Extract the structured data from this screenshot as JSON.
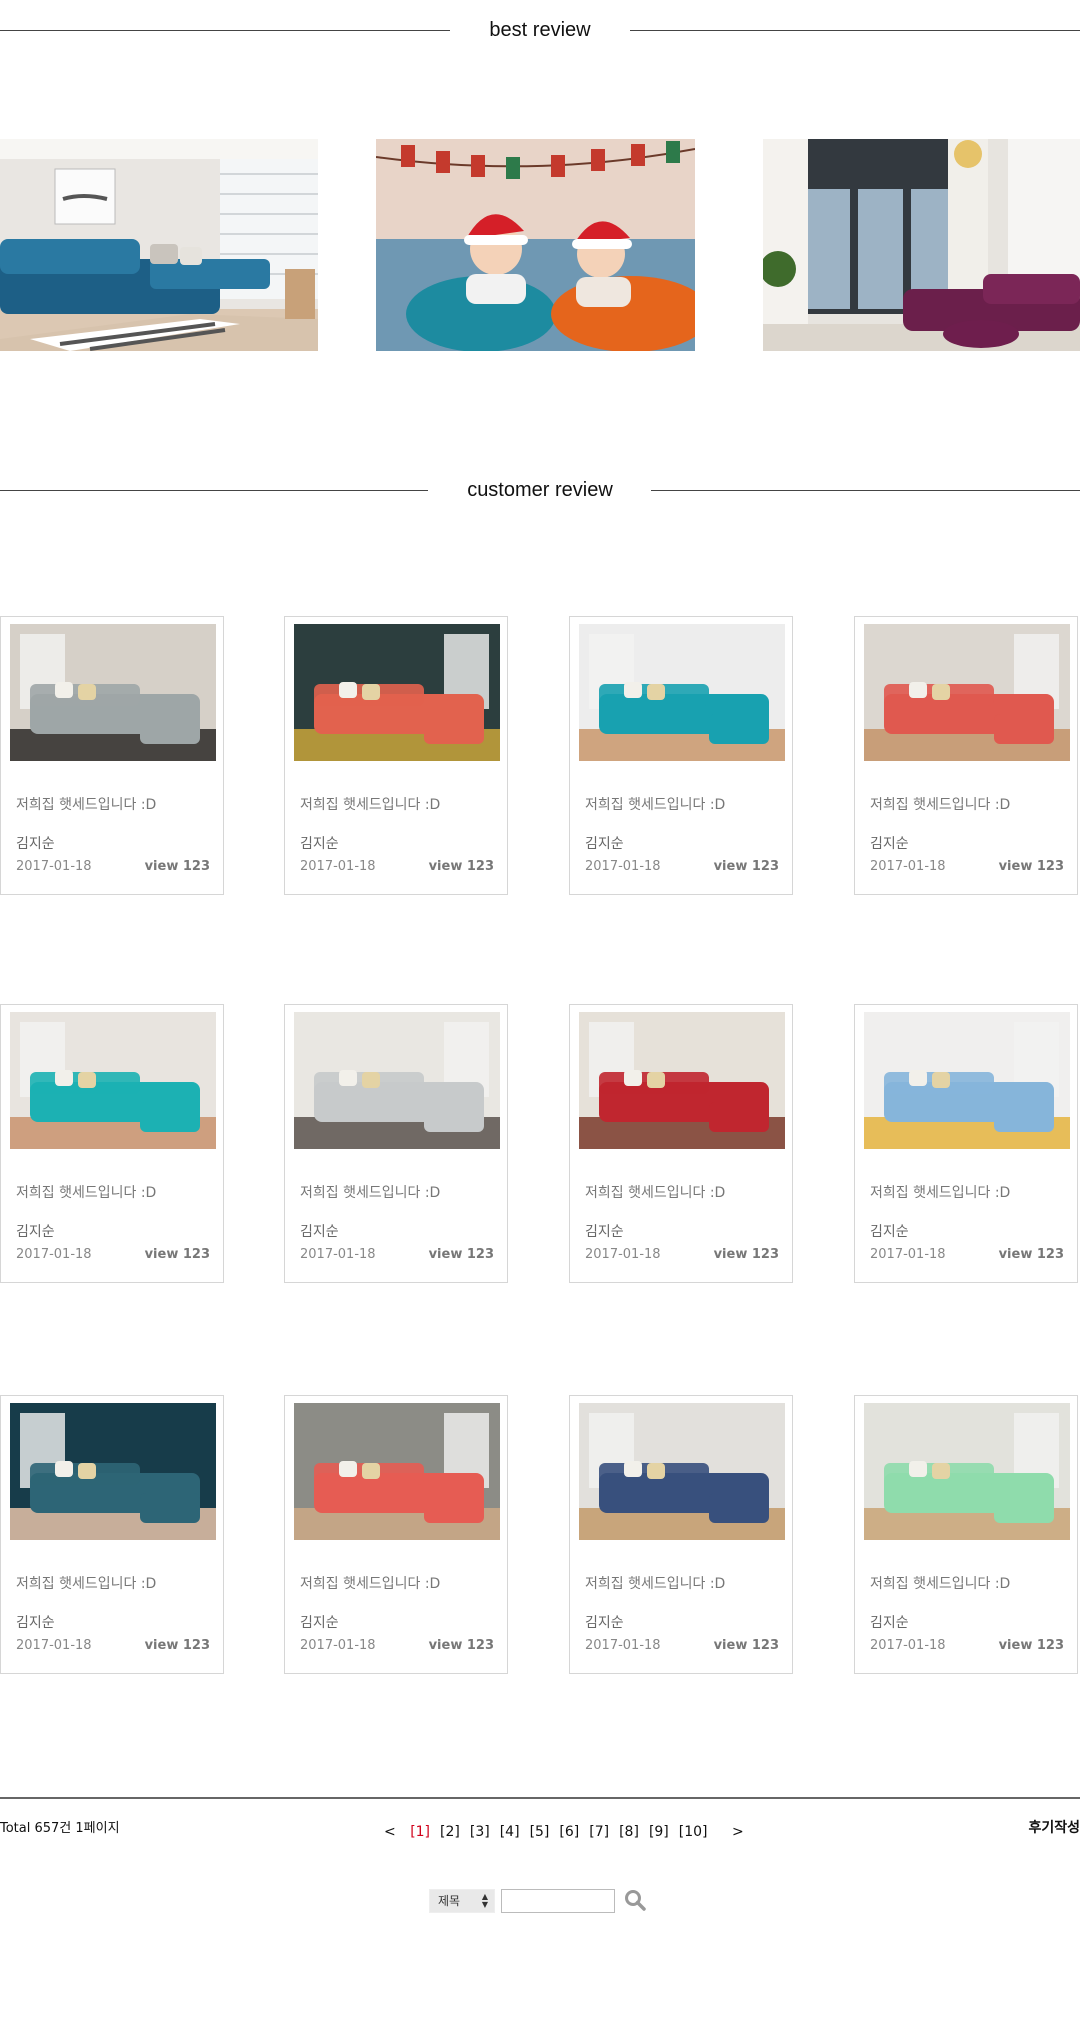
{
  "best_review": {
    "title": "best review",
    "images": [
      {
        "alt": "blue sofa living room",
        "icon": "sofa-photo"
      },
      {
        "alt": "children with santa hats and pillows",
        "icon": "kids-photo"
      },
      {
        "alt": "purple sofa with tall windows",
        "icon": "sofa-photo"
      }
    ]
  },
  "customer_review": {
    "title": "customer review",
    "cards": [
      {
        "title": "저희집 햇세드입니다 :D",
        "author": "김지순",
        "date": "2017-01-18",
        "views": "view 123"
      },
      {
        "title": "저희집 햇세드입니다 :D",
        "author": "김지순",
        "date": "2017-01-18",
        "views": "view 123"
      },
      {
        "title": "저희집 햇세드입니다 :D",
        "author": "김지순",
        "date": "2017-01-18",
        "views": "view 123"
      },
      {
        "title": "저희집 햇세드입니다 :D",
        "author": "김지순",
        "date": "2017-01-18",
        "views": "view 123"
      },
      {
        "title": "저희집 햇세드입니다 :D",
        "author": "김지순",
        "date": "2017-01-18",
        "views": "view 123"
      },
      {
        "title": "저희집 햇세드입니다 :D",
        "author": "김지순",
        "date": "2017-01-18",
        "views": "view 123"
      },
      {
        "title": "저희집 햇세드입니다 :D",
        "author": "김지순",
        "date": "2017-01-18",
        "views": "view 123"
      },
      {
        "title": "저희집 햇세드입니다 :D",
        "author": "김지순",
        "date": "2017-01-18",
        "views": "view 123"
      },
      {
        "title": "저희집 햇세드입니다 :D",
        "author": "김지순",
        "date": "2017-01-18",
        "views": "view 123"
      },
      {
        "title": "저희집 햇세드입니다 :D",
        "author": "김지순",
        "date": "2017-01-18",
        "views": "view 123"
      },
      {
        "title": "저희집 햇세드입니다 :D",
        "author": "김지순",
        "date": "2017-01-18",
        "views": "view 123"
      },
      {
        "title": "저희집 햇세드입니다 :D",
        "author": "김지순",
        "date": "2017-01-18",
        "views": "view 123"
      }
    ]
  },
  "footer": {
    "total": "Total 657건 1페이지",
    "prev": "<",
    "pages": [
      "[1]",
      "[2]",
      "[3]",
      "[4]",
      "[5]",
      "[6]",
      "[7]",
      "[8]",
      "[9]",
      "[10]"
    ],
    "active_page": "[1]",
    "next": ">",
    "write": "후기작성",
    "search_select": "제목",
    "search_placeholder": ""
  },
  "colors": {
    "accent": "#d0021b",
    "line": "#444444",
    "card_border": "#d6d6d6"
  }
}
